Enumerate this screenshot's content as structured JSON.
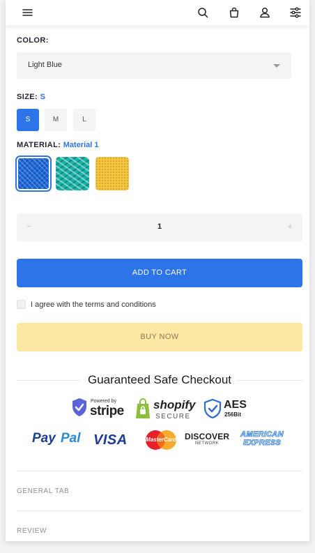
{
  "header": {
    "icons": [
      "menu-icon",
      "search-icon",
      "cart-bag-icon",
      "user-icon",
      "filter-icon"
    ]
  },
  "color": {
    "label": "COLOR:",
    "selected": "Light Blue"
  },
  "size": {
    "label": "SIZE:",
    "selected": "S",
    "options": [
      "S",
      "M",
      "L"
    ]
  },
  "material": {
    "label": "MATERIAL:",
    "selected": "Material 1",
    "swatch_colors": [
      "#1d6ad8",
      "#18b2a6",
      "#f2c545"
    ]
  },
  "quantity": {
    "minus": "−",
    "value": "1",
    "plus": "+"
  },
  "actions": {
    "add_to_cart": "ADD TO CART",
    "agree_text": "I agree with the terms and conditions",
    "buy_now": "BUY NOW"
  },
  "checkout": {
    "title": "Guaranteed Safe Checkout",
    "stripe_small": "Powered by",
    "stripe": "stripe",
    "shopify": "shopify",
    "shopify_sub": "SECURE",
    "aes": "AES",
    "aes_sub": "256Bit",
    "paypal_1": "Pay",
    "paypal_2": "Pal",
    "visa": "VISA",
    "mastercard": "MasterCard",
    "discover": "DISCOVER",
    "discover_sub": "NETWORK",
    "amex_1": "AMERICAN",
    "amex_2": "EXPRESS"
  },
  "tabs": [
    "GENERAL TAB",
    "REVIEW"
  ],
  "colors": {
    "accent": "#2d74e8",
    "buy_now_bg": "#fbe8a3",
    "field_bg": "#f4f4f6"
  }
}
